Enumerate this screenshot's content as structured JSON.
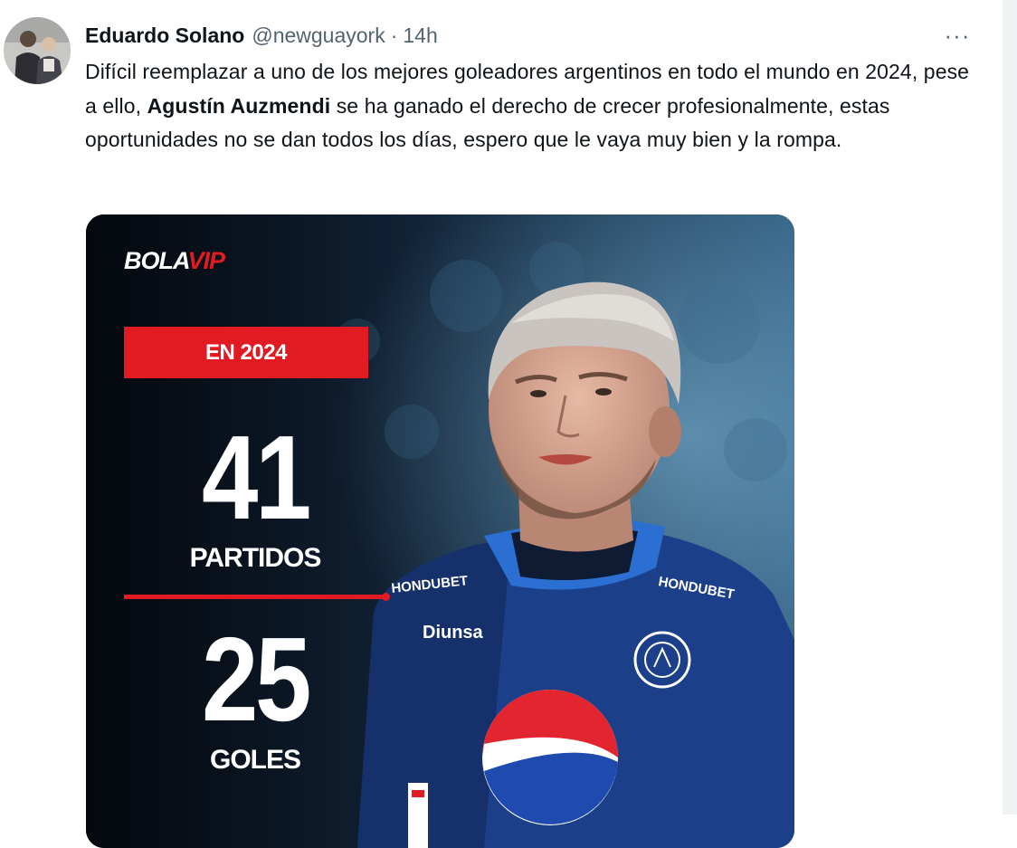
{
  "tweet": {
    "author": {
      "display_name": "Eduardo Solano",
      "handle": "@newguayork",
      "separator": "·",
      "time": "14h"
    },
    "more_label": "···",
    "text_parts": [
      "Difícil reemplazar a uno de los mejores goleadores argentinos en todo el mundo en 2024, pese a ello, ",
      "Agustín Auzmendi",
      " se ha ganado el derecho de crecer profesionalmente, estas oportunidades no se dan todos los días, espero que le vaya muy bien y la rompa."
    ]
  },
  "media": {
    "brand": {
      "part1": "BOLA",
      "part2": "VIP"
    },
    "year_label": "EN 2024",
    "stats": [
      {
        "value": "41",
        "label": "PARTIDOS"
      },
      {
        "value": "25",
        "label": "GOLES"
      }
    ],
    "jersey": {
      "left_chest": "HONDUBET",
      "right_chest": "HONDUBET",
      "sponsor": "Diunsa"
    }
  },
  "colors": {
    "accent_red": "#e21b23",
    "text_primary": "#0f1419",
    "text_secondary": "#536471",
    "jersey_blue": "#1c3f8a"
  }
}
